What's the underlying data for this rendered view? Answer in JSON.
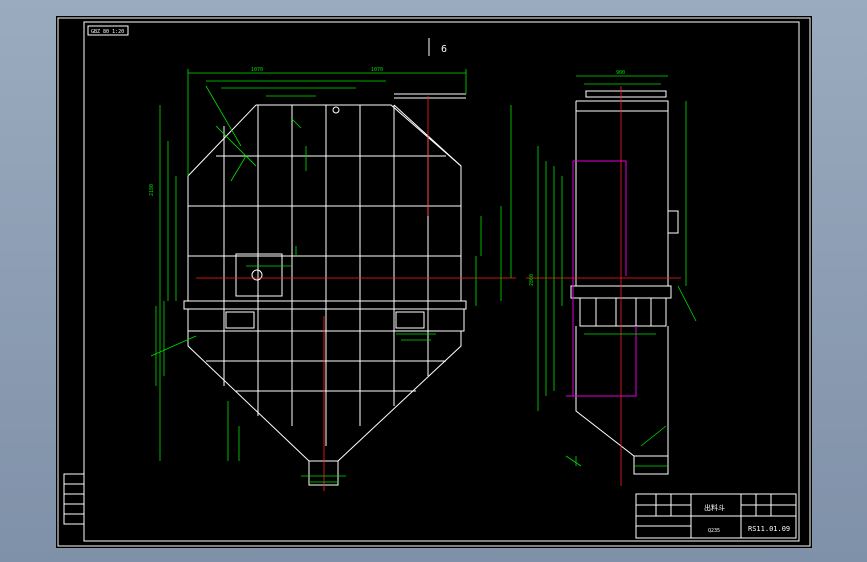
{
  "drawing": {
    "view_marker": "6",
    "title_block": {
      "part_name": "出料斗",
      "material": "Q235",
      "drawing_number": "RS11.01.09"
    },
    "top_left_tag": "GBZ 80 1:20",
    "dims": {
      "top_left": "1070",
      "top_right": "1070",
      "height_main": "2180",
      "side_width": "900",
      "side_height": "2860"
    }
  },
  "colors": {
    "frame": "#ffffff",
    "dimension": "#00e000",
    "centerline": "#ff2020",
    "hidden": "#e000e0"
  }
}
